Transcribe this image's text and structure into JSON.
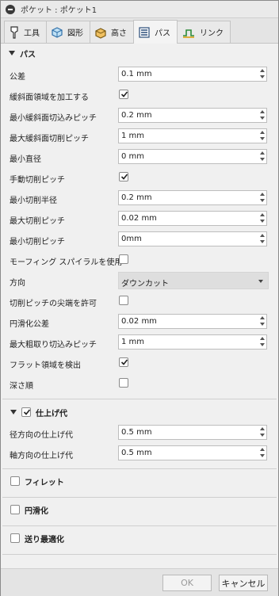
{
  "window": {
    "title": "ポケット : ポケット1"
  },
  "tabs": [
    {
      "label": "工具",
      "icon": "tool-icon"
    },
    {
      "label": "図形",
      "icon": "geometry-icon"
    },
    {
      "label": "高さ",
      "icon": "heights-icon"
    },
    {
      "label": "パス",
      "icon": "passes-icon",
      "active": true
    },
    {
      "label": "リンク",
      "icon": "linking-icon"
    }
  ],
  "passes": {
    "header": "パス",
    "tolerance": {
      "label": "公差",
      "value": "0.1 mm"
    },
    "machine_shallow": {
      "label": "緩斜面領域を加工する",
      "checked": true
    },
    "min_shallow_stepdown": {
      "label": "最小緩斜面切込みピッチ",
      "value": "0.2 mm"
    },
    "max_shallow_stepover": {
      "label": "最大緩斜面切削ピッチ",
      "value": "1 mm"
    },
    "min_diameter": {
      "label": "最小直径",
      "value": "0 mm"
    },
    "manual_stepover": {
      "label": "手動切削ピッチ",
      "checked": true
    },
    "min_cutting_radius": {
      "label": "最小切削半径",
      "value": "0.2 mm"
    },
    "max_stepover": {
      "label": "最大切削ピッチ",
      "value": "0.02 mm"
    },
    "min_stepover": {
      "label": "最小切削ピッチ",
      "value": "0mm"
    },
    "morphing_spiral": {
      "label": "モーフィング スパイラルを使用",
      "checked": false
    },
    "direction": {
      "label": "方向",
      "value": "ダウンカット"
    },
    "allow_stepover_cusps": {
      "label": "切削ピッチの尖端を許可",
      "checked": false
    },
    "smoothing_deviation": {
      "label": "円滑化公差",
      "value": "0.02 mm"
    },
    "max_roughing_stepdown": {
      "label": "最大粗取り切込みピッチ",
      "value": "1 mm"
    },
    "detect_flat_areas": {
      "label": "フラット領域を検出",
      "checked": true
    },
    "depth_first": {
      "label": "深さ順",
      "checked": false
    }
  },
  "stock_to_leave": {
    "header": "仕上げ代",
    "checked": true,
    "radial": {
      "label": "径方向の仕上げ代",
      "value": "0.5 mm"
    },
    "axial": {
      "label": "軸方向の仕上げ代",
      "value": "0.5 mm"
    }
  },
  "sections": [
    {
      "label": "フィレット",
      "checked": false
    },
    {
      "label": "円滑化",
      "checked": false
    },
    {
      "label": "送り最適化",
      "checked": false
    }
  ],
  "footer": {
    "ok_label": "OK",
    "cancel_label": "キャンセル"
  },
  "colors": {
    "panel": "#f0f0f0",
    "field_border": "#bdbdbd",
    "dropdown_bg": "#dedede"
  }
}
